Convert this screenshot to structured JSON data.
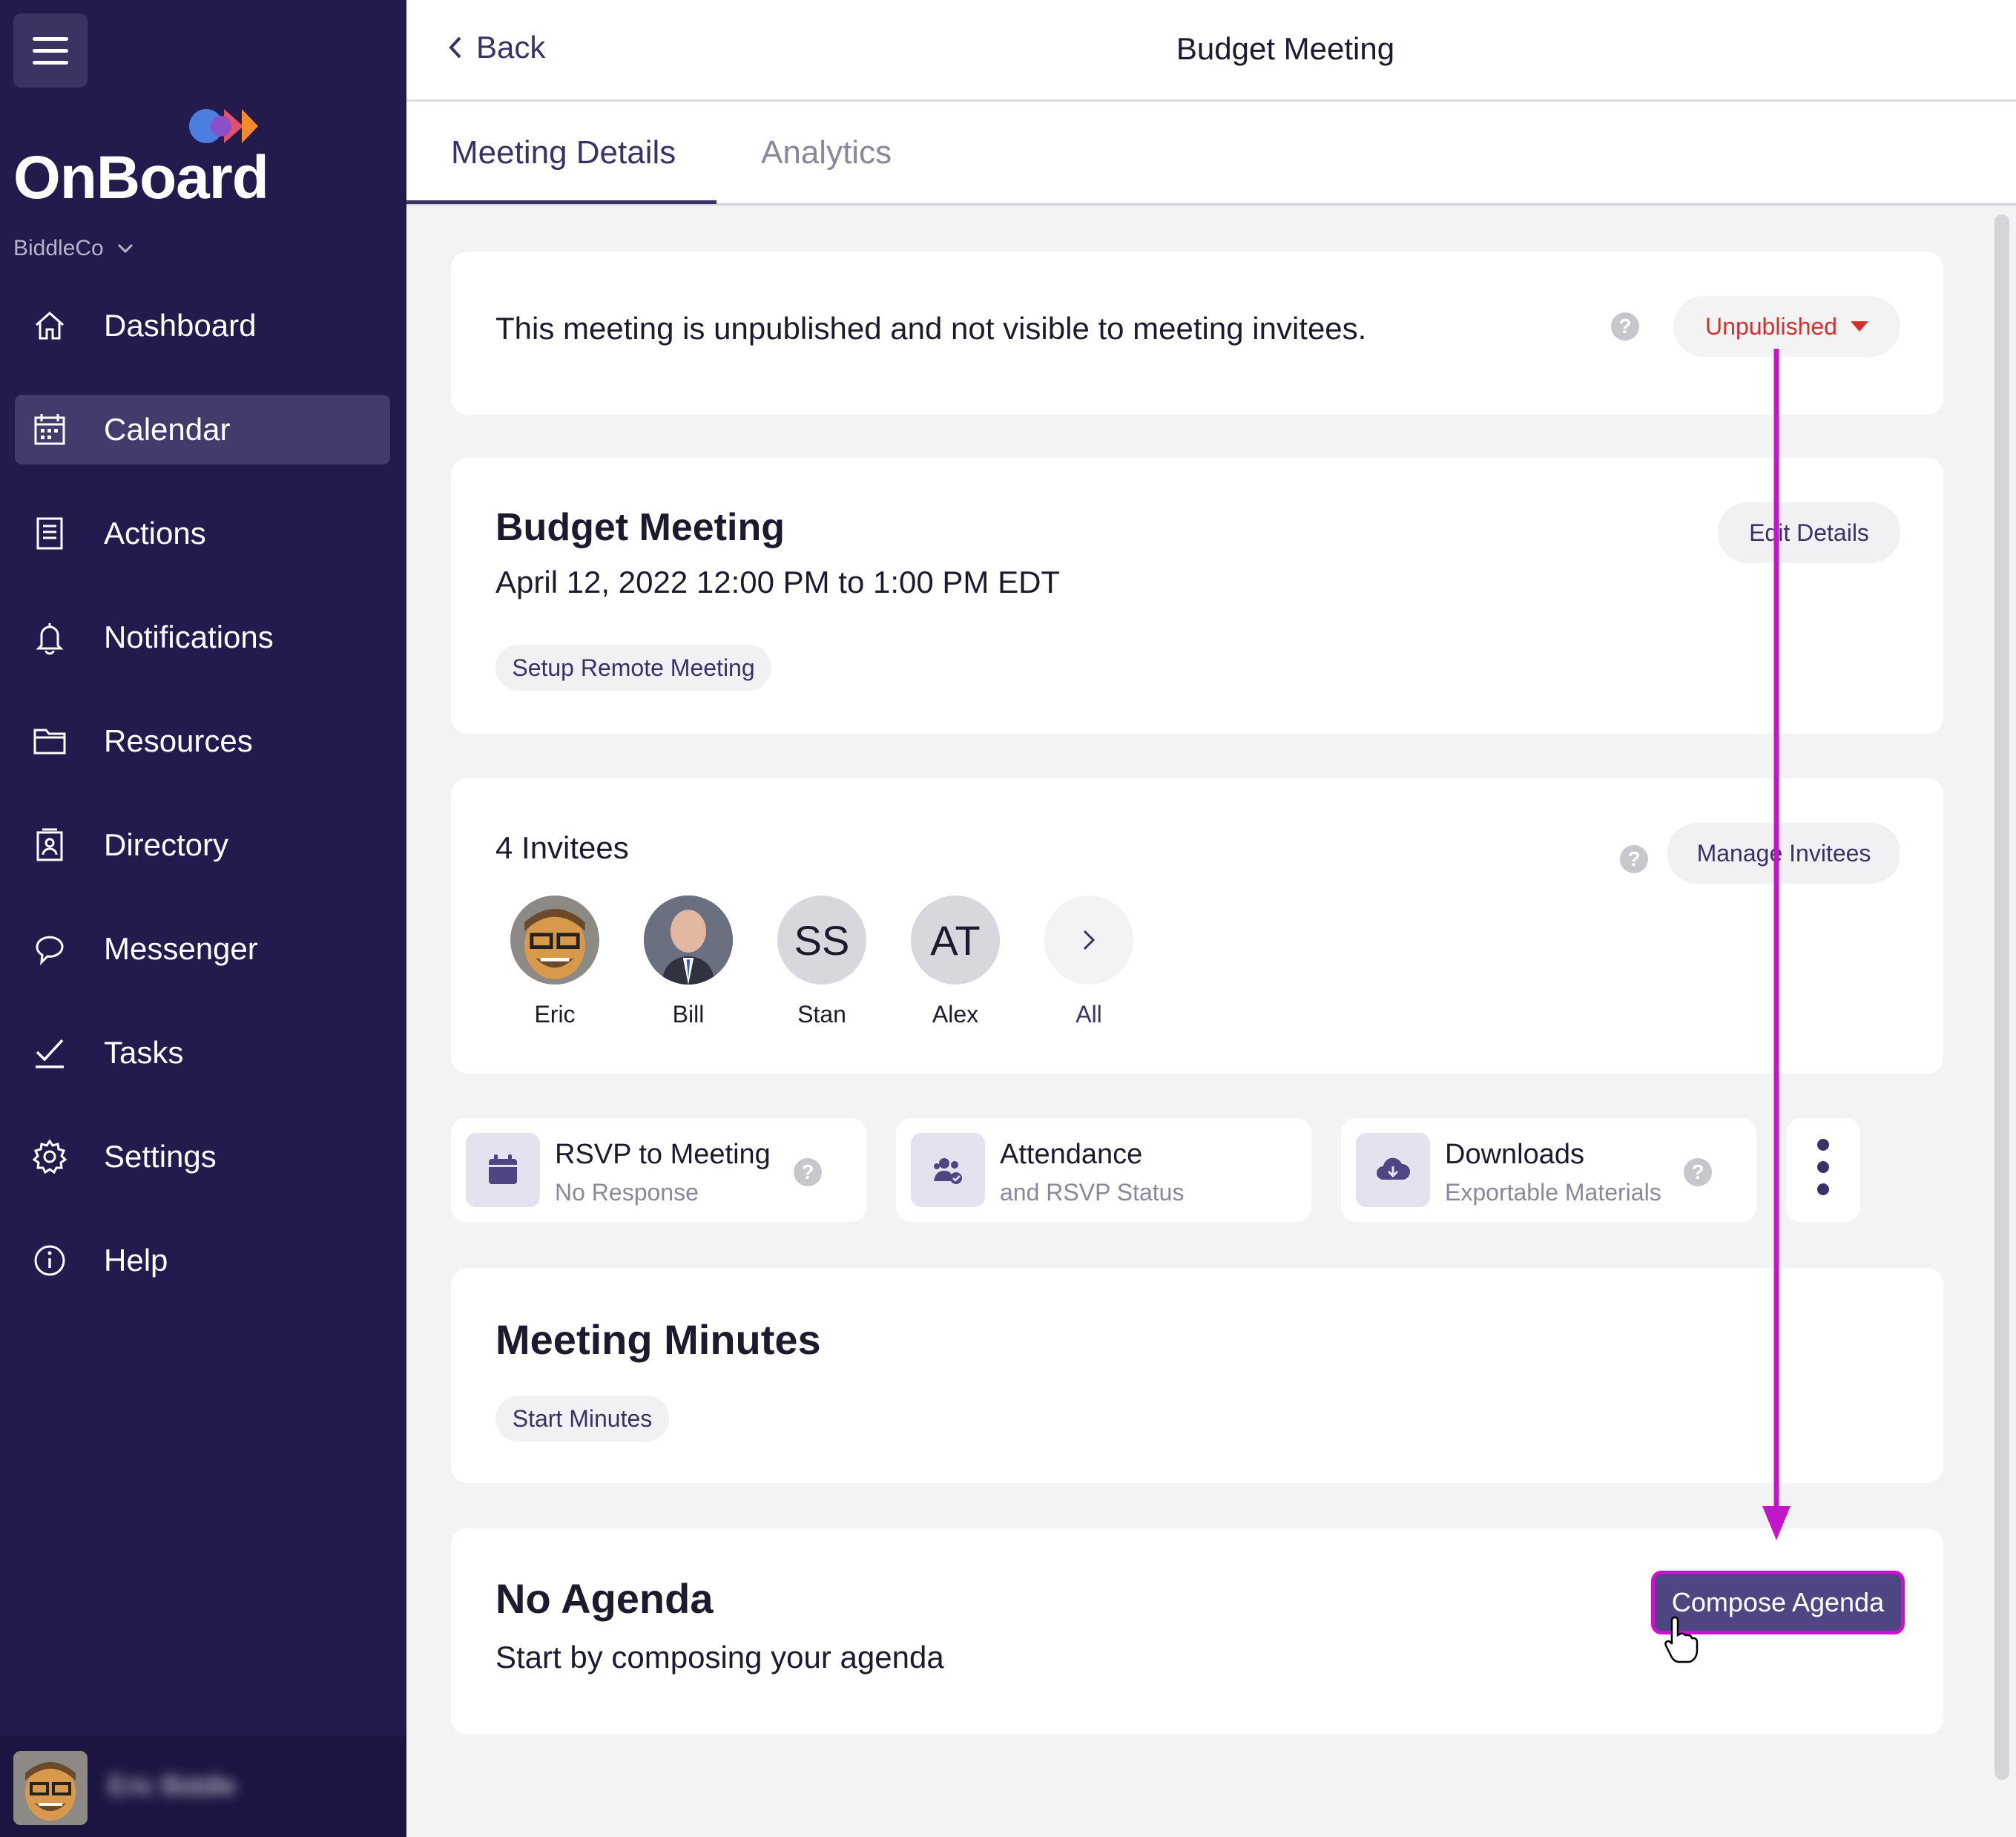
{
  "sidebar": {
    "logo_text": "OnBoard",
    "org_name": "BiddleCo",
    "items": [
      {
        "label": "Dashboard",
        "icon": "home-icon"
      },
      {
        "label": "Calendar",
        "icon": "calendar-icon"
      },
      {
        "label": "Actions",
        "icon": "checklist-icon"
      },
      {
        "label": "Notifications",
        "icon": "bell-icon"
      },
      {
        "label": "Resources",
        "icon": "folder-icon"
      },
      {
        "label": "Directory",
        "icon": "contacts-icon"
      },
      {
        "label": "Messenger",
        "icon": "chat-icon"
      },
      {
        "label": "Tasks",
        "icon": "check-icon"
      },
      {
        "label": "Settings",
        "icon": "gear-icon"
      },
      {
        "label": "Help",
        "icon": "info-icon"
      }
    ],
    "active_item": "Calendar",
    "user_name": "Eric Biddle"
  },
  "header": {
    "back_label": "Back",
    "title": "Budget Meeting"
  },
  "tabs": [
    {
      "label": "Meeting Details",
      "active": true
    },
    {
      "label": "Analytics",
      "active": false
    }
  ],
  "publish_card": {
    "message": "This meeting is unpublished and not visible to meeting invitees.",
    "help": "?",
    "status_label": "Unpublished"
  },
  "meeting_card": {
    "title": "Budget Meeting",
    "datetime": "April 12, 2022 12:00 PM to 1:00 PM EDT",
    "edit_label": "Edit Details",
    "remote_label": "Setup Remote Meeting"
  },
  "invitees_card": {
    "count_label": "4 Invitees",
    "help": "?",
    "manage_label": "Manage Invitees",
    "invitees": [
      {
        "name": "Eric",
        "initials": "",
        "avatar": "cartoon-avatar"
      },
      {
        "name": "Bill",
        "initials": "",
        "avatar": "photo-avatar"
      },
      {
        "name": "Stan",
        "initials": "SS",
        "avatar": "initials"
      },
      {
        "name": "Alex",
        "initials": "AT",
        "avatar": "initials"
      }
    ],
    "all_label": "All"
  },
  "tiles": [
    {
      "title": "RSVP to Meeting",
      "subtitle": "No Response",
      "icon": "calendar-icon",
      "help": "?"
    },
    {
      "title": "Attendance",
      "subtitle": "and RSVP Status",
      "icon": "people-icon"
    },
    {
      "title": "Downloads",
      "subtitle": "Exportable Materials",
      "icon": "cloud-download-icon",
      "help": "?"
    }
  ],
  "minutes_card": {
    "title": "Meeting Minutes",
    "button_label": "Start Minutes"
  },
  "agenda_card": {
    "title": "No Agenda",
    "subtitle": "Start by composing your agenda",
    "button_label": "Compose Agenda"
  },
  "colors": {
    "sidebar_bg": "#231a4d",
    "accent": "#3a3266",
    "unpublished": "#d32f2f",
    "annotation": "#c416c8"
  }
}
